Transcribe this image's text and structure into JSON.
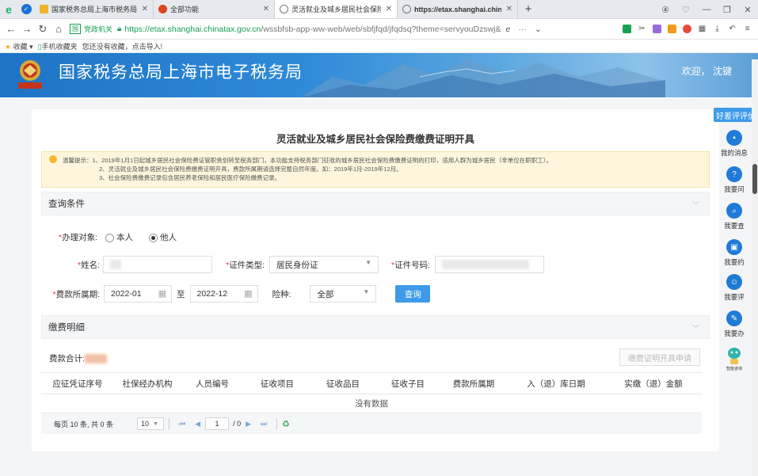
{
  "browser": {
    "tabs": [
      {
        "title": "国家税务总局上海市税务局",
        "icon_color": "#f0b32c"
      },
      {
        "title": "全部功能",
        "icon_color": "#d9481c"
      },
      {
        "title": "灵活就业及城乡居民社会保险费",
        "icon_color": "#777777",
        "active": true
      },
      {
        "title": "https://etax.shanghai.chin",
        "icon_color": "#777777"
      }
    ],
    "gov_badge": "党政机关",
    "url_host": "https://etax.shanghai.chinatax.gov.cn",
    "url_path": "/wssbfsb-app-ww-web/web/sbfjfqd/jfqdsq?theme=servyouDzswj&",
    "bookmarks": {
      "favorites": "收藏",
      "mobile": "手机收藏夹",
      "hint": "您还没有收藏，点击导入!"
    }
  },
  "banner": {
    "title": "国家税务总局上海市电子税务局",
    "welcome": "欢迎，  沈键"
  },
  "page": {
    "title": "灵活就业及城乡居民社会保险费缴费证明开具",
    "notice_lines": [
      "温馨提示：1、2019年1月1日起城乡居民社会保险费证管职责划转至税务部门，本功能支持税务部门征收的城乡居民社会保险费缴费证明的打印，适用人群为城乡居民（非单位在职职工）。",
      "2、灵活就业及城乡居民社会保险费缴费证明开具，费款所属期请选择完整自然年度。如：2019年1月-2019年12月。",
      "3、社会保险费缴费记录包含居民养老保险和居民医疗保险缴费记录。"
    ]
  },
  "query": {
    "section_title": "查询条件",
    "target_label": "办理对象:",
    "opt_self": "本人",
    "opt_other": "他人",
    "name_label": "姓名:",
    "id_type_label": "证件类型:",
    "id_type_value": "居民身份证",
    "id_no_label": "证件号码:",
    "period_label": "费款所属期:",
    "period_from": "2022-01",
    "to_word": "至",
    "period_to": "2022-12",
    "insurance_label": "险种:",
    "insurance_value": "全部",
    "query_button": "查询"
  },
  "detail": {
    "section_title": "缴费明细",
    "total_label": "费款合计:",
    "cert_button": "缴费证明开具申请",
    "columns": [
      "应征凭证序号",
      "社保经办机构",
      "人员编号",
      "征收项目",
      "征收品目",
      "征收子目",
      "费款所属期",
      "入（退）库日期",
      "实缴（退）金额"
    ],
    "empty_text": "没有数据",
    "pager_info": "每页 10 条, 共 0 条",
    "page_size": "10",
    "current_page": "1",
    "total_pages": "/ 0"
  },
  "rail": {
    "review": "好差评评价",
    "items": [
      "我的消息",
      "我要问",
      "我要查",
      "我要约",
      "我要评",
      "我要办",
      "智能咨询"
    ]
  }
}
